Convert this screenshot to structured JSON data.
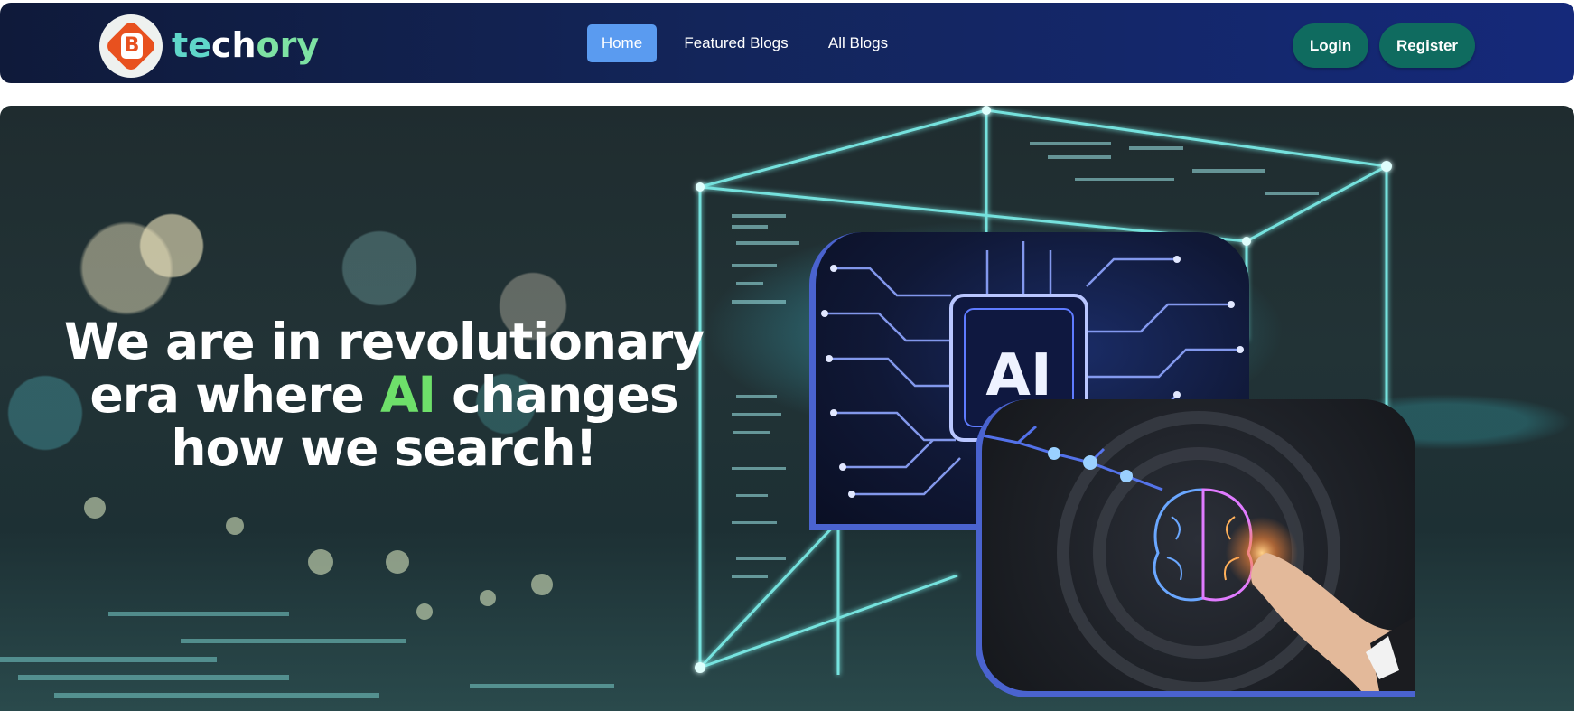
{
  "brand": {
    "name_part1": "te",
    "name_part2": "ch",
    "name_part3": "ory",
    "logo_letter": "B"
  },
  "nav": {
    "items": [
      {
        "label": "Home",
        "active": true
      },
      {
        "label": "Featured Blogs",
        "active": false
      },
      {
        "label": "All Blogs",
        "active": false
      }
    ],
    "login_label": "Login",
    "register_label": "Register"
  },
  "hero": {
    "title_line1": "We are in revolutionary",
    "title_line2_before": "era where ",
    "title_line2_highlight": "AI",
    "title_line2_after": " changes",
    "title_line3": "how we search!",
    "chip_label": "AI"
  },
  "colors": {
    "nav_active_bg": "#5a9bf0",
    "auth_button_bg": "#0f6b5f",
    "highlight_green": "#6ee06a",
    "brand_teal": "#5fd6c9",
    "photo_border": "#4a63cf"
  }
}
